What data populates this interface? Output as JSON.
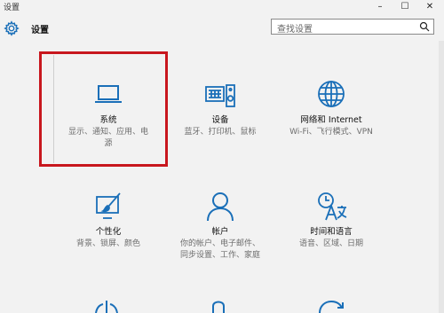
{
  "window": {
    "title": "设置",
    "minimize": "–",
    "maximize": "☐",
    "close": "✕"
  },
  "header": {
    "title": "设置",
    "search_placeholder": "查找设置"
  },
  "items": [
    {
      "name": "系统",
      "desc_line1": "显示、通知、应用、电",
      "desc_line2": "源",
      "icon": "laptop-icon"
    },
    {
      "name": "设备",
      "desc_line1": "蓝牙、打印机、鼠标",
      "desc_line2": "",
      "icon": "keyboard-speaker-icon"
    },
    {
      "name": "网络和 Internet",
      "desc_line1": "Wi-Fi、飞行模式、VPN",
      "desc_line2": "",
      "icon": "globe-icon"
    },
    {
      "name": "个性化",
      "desc_line1": "背景、锁屏、颜色",
      "desc_line2": "",
      "icon": "paint-icon"
    },
    {
      "name": "帐户",
      "desc_line1": "你的帐户、电子邮件、",
      "desc_line2": "同步设置、工作、家庭",
      "icon": "person-icon"
    },
    {
      "name": "时间和语言",
      "desc_line1": "语音、区域、日期",
      "desc_line2": "",
      "icon": "time-language-icon"
    }
  ],
  "colors": {
    "accent": "#1a6fb8",
    "highlight": "#c8171e"
  }
}
